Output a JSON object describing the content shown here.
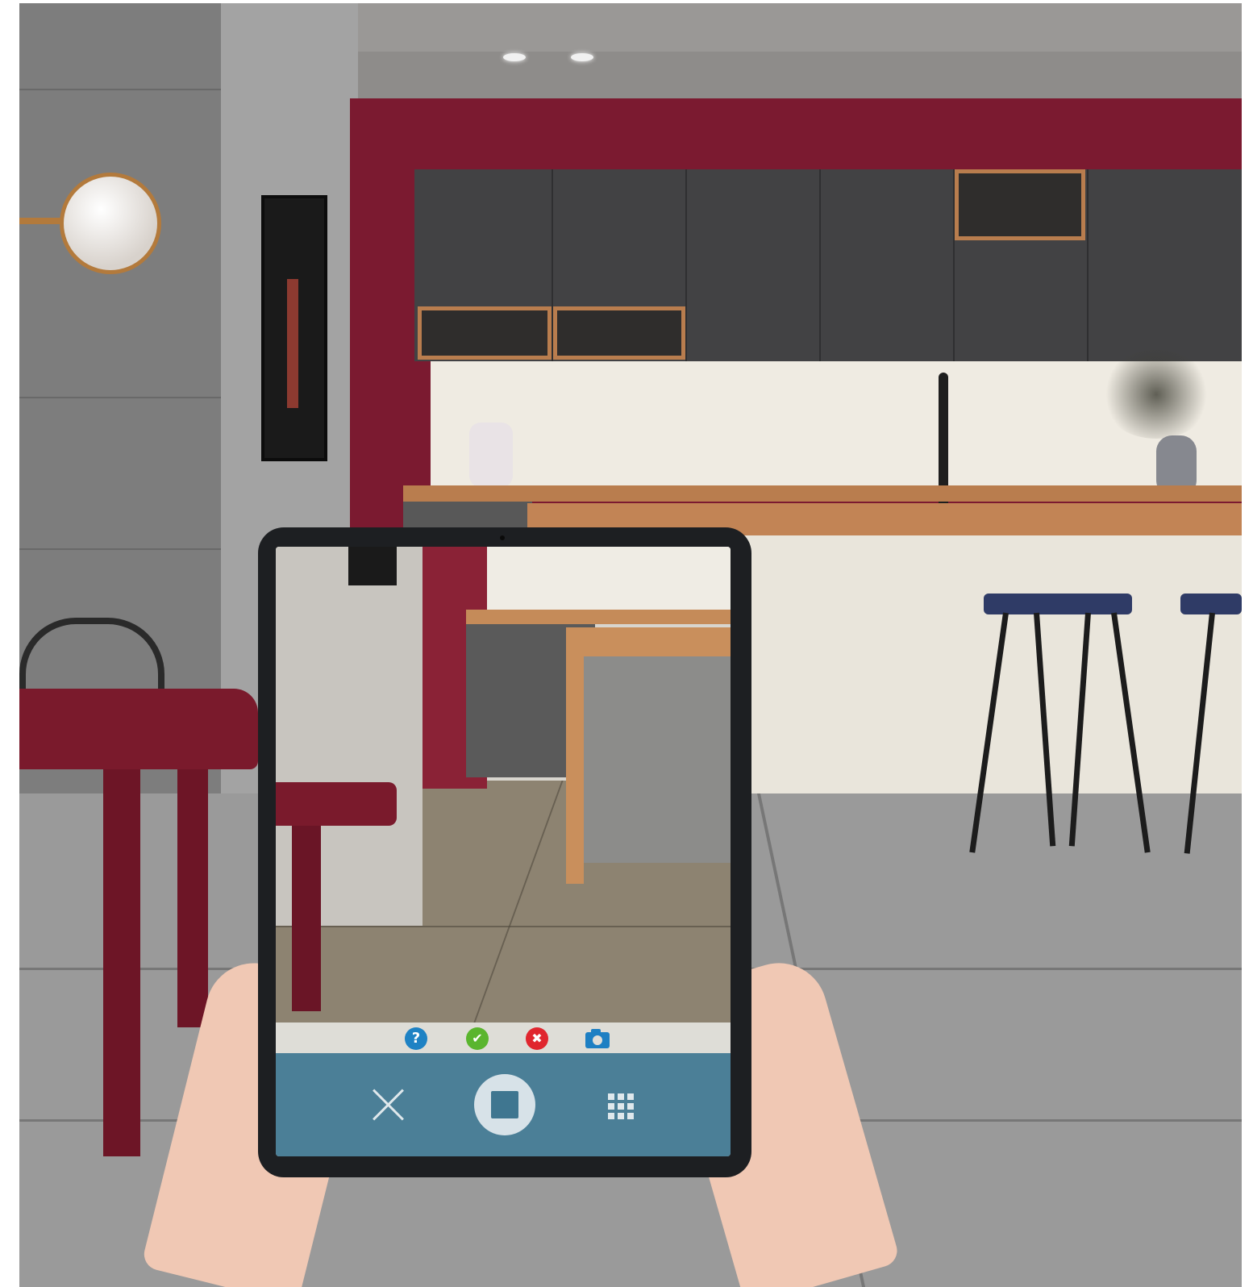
{
  "ar_app": {
    "tools": [
      {
        "icon": "help-icon",
        "glyph": "?",
        "color": "#1e82c4"
      },
      {
        "icon": "check-icon",
        "glyph": "✔",
        "color": "#5ab52e"
      },
      {
        "icon": "cancel-icon",
        "glyph": "✖",
        "color": "#e0262e"
      },
      {
        "icon": "camera-icon",
        "color": "#1d7fc3"
      }
    ],
    "controls": [
      {
        "icon": "close-icon",
        "color": "#dfe8ec"
      },
      {
        "icon": "shutter-icon",
        "color": "#d7e2e8"
      },
      {
        "icon": "grid-menu-icon",
        "color": "#dfe8ec"
      }
    ],
    "panel_color": "#4b7f97"
  },
  "scene": {
    "accent_wall_color": "#7b1a30",
    "wood_color": "#c28455",
    "cabinet_color": "#424244",
    "floor_color": "#9a9a9a"
  }
}
